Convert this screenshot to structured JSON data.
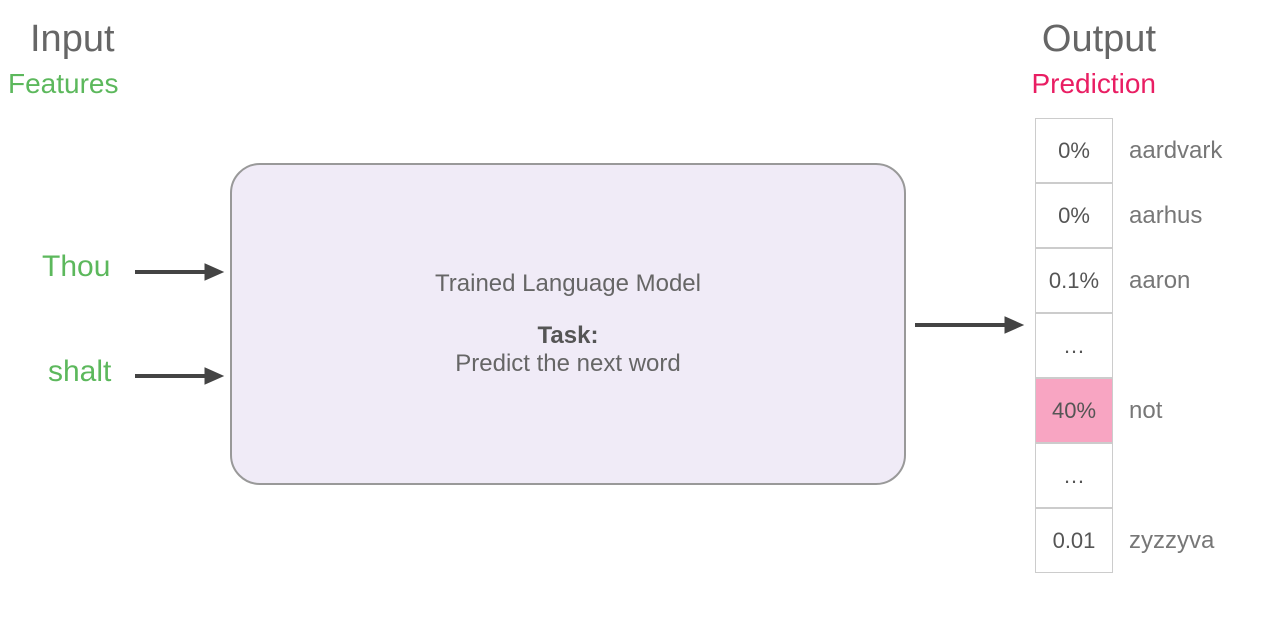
{
  "headers": {
    "input": "Input",
    "features": "Features",
    "output": "Output",
    "prediction": "Prediction"
  },
  "input_words": {
    "word1": "Thou",
    "word2": "shalt"
  },
  "model": {
    "title": "Trained Language Model",
    "task_label": "Task:",
    "task_text": "Predict the next word"
  },
  "output_rows": [
    {
      "percent": "0%",
      "word": "aardvark",
      "highlighted": false
    },
    {
      "percent": "0%",
      "word": "aarhus",
      "highlighted": false
    },
    {
      "percent": "0.1%",
      "word": "aaron",
      "highlighted": false
    },
    {
      "percent": "…",
      "word": "",
      "highlighted": false
    },
    {
      "percent": "40%",
      "word": "not",
      "highlighted": true
    },
    {
      "percent": "…",
      "word": "",
      "highlighted": false
    },
    {
      "percent": "0.01",
      "word": "zyzzyva",
      "highlighted": false
    }
  ]
}
